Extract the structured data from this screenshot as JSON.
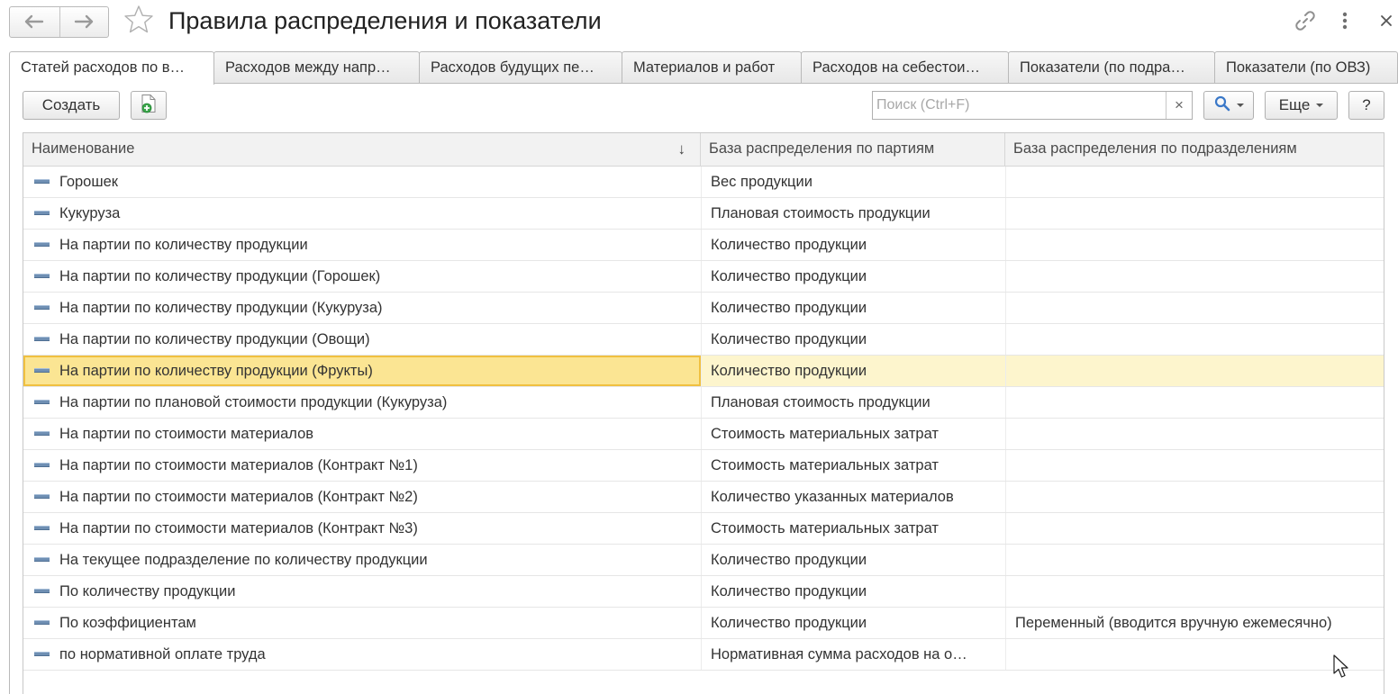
{
  "window": {
    "title": "Правила распределения и показатели",
    "back_icon": "arrow-left-icon",
    "forward_icon": "arrow-right-icon",
    "favorite_icon": "star-icon",
    "link_icon": "link-icon",
    "more_icon": "vertical-dots-icon",
    "close_icon": "close-icon"
  },
  "tabs": [
    {
      "label": "Статей расходов по в…",
      "active": true
    },
    {
      "label": "Расходов между напр…",
      "active": false
    },
    {
      "label": "Расходов будущих пе…",
      "active": false
    },
    {
      "label": "Материалов и работ",
      "active": false
    },
    {
      "label": "Расходов на себестои…",
      "active": false
    },
    {
      "label": "Показатели (по подра…",
      "active": false
    },
    {
      "label": "Показатели (по ОВЗ)",
      "active": false
    }
  ],
  "toolbar": {
    "create_label": "Создать",
    "search_placeholder": "Поиск (Ctrl+F)",
    "clear_label": "×",
    "more_label": "Еще",
    "help_label": "?"
  },
  "table": {
    "columns": [
      "Наименование",
      "База распределения по партиям",
      "База распределения по подразделениям"
    ],
    "sort_indicator": "↓",
    "selected_row": 6,
    "rows": [
      {
        "name": "Горошек",
        "batch_base": "Вес продукции",
        "division_base": ""
      },
      {
        "name": "Кукуруза",
        "batch_base": "Плановая стоимость продукции",
        "division_base": ""
      },
      {
        "name": "На партии по количеству продукции",
        "batch_base": "Количество продукции",
        "division_base": ""
      },
      {
        "name": "На партии по количеству продукции (Горошек)",
        "batch_base": "Количество продукции",
        "division_base": ""
      },
      {
        "name": "На партии по количеству продукции (Кукуруза)",
        "batch_base": "Количество продукции",
        "division_base": ""
      },
      {
        "name": "На партии по количеству продукции (Овощи)",
        "batch_base": "Количество продукции",
        "division_base": ""
      },
      {
        "name": "На партии по количеству продукции (Фрукты)",
        "batch_base": "Количество продукции",
        "division_base": ""
      },
      {
        "name": "На партии по плановой стоимости продукции (Кукуруза)",
        "batch_base": "Плановая стоимость продукции",
        "division_base": ""
      },
      {
        "name": "На партии по стоимости материалов",
        "batch_base": "Стоимость материальных затрат",
        "division_base": ""
      },
      {
        "name": "На партии по стоимости материалов (Контракт №1)",
        "batch_base": "Стоимость материальных затрат",
        "division_base": ""
      },
      {
        "name": "На партии по стоимости материалов (Контракт №2)",
        "batch_base": "Количество указанных материалов",
        "division_base": ""
      },
      {
        "name": "На партии по стоимости материалов (Контракт №3)",
        "batch_base": "Стоимость материальных затрат",
        "division_base": ""
      },
      {
        "name": "На текущее подразделение по количеству продукции",
        "batch_base": "Количество продукции",
        "division_base": ""
      },
      {
        "name": "По количеству продукции",
        "batch_base": "Количество продукции",
        "division_base": ""
      },
      {
        "name": "По коэффициентам",
        "batch_base": "Количество продукции",
        "division_base": "Переменный (вводится вручную ежемесячно)"
      },
      {
        "name": "по нормативной оплате труда",
        "batch_base": "Нормативная сумма расходов на о…",
        "division_base": ""
      }
    ]
  },
  "colors": {
    "selected_row": "#fdf5cd",
    "selected_cell": "#fbe593",
    "selected_outline": "#f0c040",
    "row_icon": "#6f8fb3",
    "search_icon": "#3a78c8",
    "add_icon": "#3aa64a"
  }
}
